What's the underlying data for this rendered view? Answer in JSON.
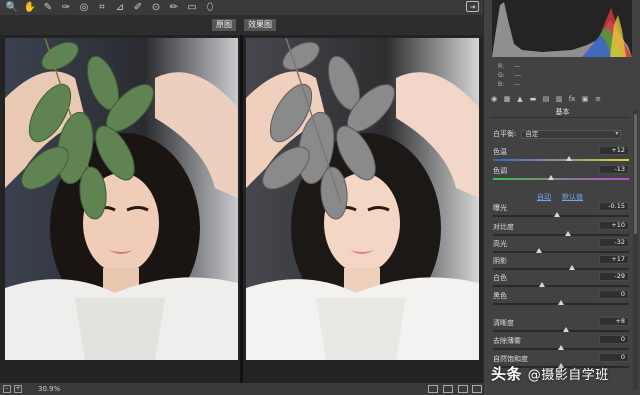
{
  "toolbar": {
    "tools": [
      {
        "name": "zoom-tool-icon",
        "glyph": "🔍"
      },
      {
        "name": "hand-tool-icon",
        "glyph": "✋"
      },
      {
        "name": "white-balance-tool-icon",
        "glyph": "✎"
      },
      {
        "name": "color-sampler-tool-icon",
        "glyph": "✑"
      },
      {
        "name": "targeted-adjustment-tool-icon",
        "glyph": "◎"
      },
      {
        "name": "crop-tool-icon",
        "glyph": "⌗"
      },
      {
        "name": "straighten-tool-icon",
        "glyph": "⊿"
      },
      {
        "name": "spot-removal-tool-icon",
        "glyph": "✐"
      },
      {
        "name": "red-eye-tool-icon",
        "glyph": "⊙"
      },
      {
        "name": "adjustment-brush-icon",
        "glyph": "✏"
      },
      {
        "name": "graduated-filter-icon",
        "glyph": "▭"
      },
      {
        "name": "radial-filter-icon",
        "glyph": "⬯"
      }
    ],
    "export_glyph": "⇥"
  },
  "view": {
    "before_label": "原图",
    "after_label": "效果图"
  },
  "status": {
    "zoom": "30.9%",
    "minus": "-",
    "plus": "+"
  },
  "panel": {
    "rgb": {
      "r_label": "R:",
      "g_label": "G:",
      "b_label": "B:",
      "r": "---",
      "g": "---",
      "b": "---"
    },
    "tabs": [
      "◉",
      "▦",
      "▲",
      "▬",
      "▤",
      "▥",
      "fx",
      "▣",
      "≡"
    ],
    "section_title": "基本",
    "white_balance": {
      "label": "白平衡:",
      "value": "自定"
    },
    "auto_label": "自动",
    "default_label": "默认值",
    "sliders": [
      {
        "label": "色温",
        "value": "+12",
        "pos": 0.56,
        "track": "temp"
      },
      {
        "label": "色调",
        "value": "-13",
        "pos": 0.43,
        "track": "tint"
      },
      {
        "label": "曝光",
        "value": "-0.15",
        "pos": 0.47,
        "track": "plain"
      },
      {
        "label": "对比度",
        "value": "+10",
        "pos": 0.55,
        "track": "plain"
      },
      {
        "label": "高光",
        "value": "-32",
        "pos": 0.34,
        "track": "plain"
      },
      {
        "label": "阴影",
        "value": "+17",
        "pos": 0.58,
        "track": "plain"
      },
      {
        "label": "白色",
        "value": "-29",
        "pos": 0.36,
        "track": "plain"
      },
      {
        "label": "黑色",
        "value": "0",
        "pos": 0.5,
        "track": "plain"
      },
      {
        "label": "清晰度",
        "value": "+8",
        "pos": 0.54,
        "track": "plain"
      },
      {
        "label": "去除薄雾",
        "value": "0",
        "pos": 0.5,
        "track": "plain"
      },
      {
        "label": "自然饱和度",
        "value": "0",
        "pos": 0.5,
        "track": "plain"
      }
    ]
  },
  "watermark": {
    "text_a": "头条",
    "text_b": "@摄影自学班"
  },
  "colors": {
    "link": "#6fa8e6",
    "panel_bg": "#424242",
    "canvas_bg": "#232323"
  }
}
